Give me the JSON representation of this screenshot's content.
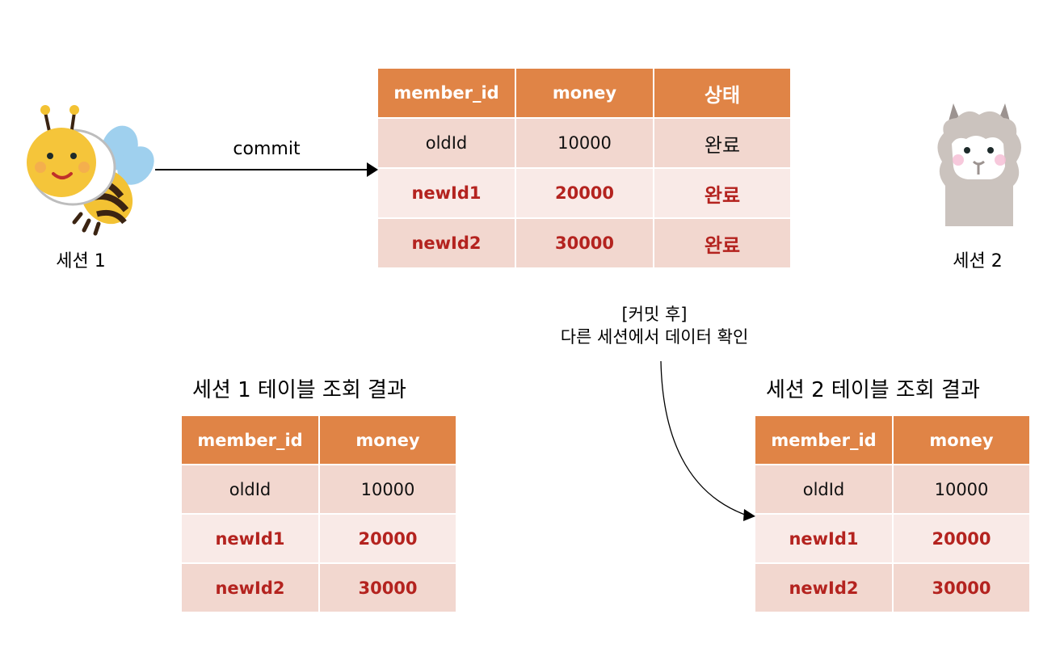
{
  "colors": {
    "header_bg": "#e08446",
    "row_odd_bg": "#f2d7cf",
    "row_even_bg": "#f9eae7",
    "highlight_text": "#b4231f",
    "normal_text": "#111111"
  },
  "session1": {
    "label": "세션 1",
    "icon": "bee-icon"
  },
  "session2": {
    "label": "세션 2",
    "icon": "alpaca-icon"
  },
  "commit_arrow": {
    "label": "commit"
  },
  "main_table": {
    "headers": [
      "member_id",
      "money",
      "상태"
    ],
    "rows": [
      {
        "cells": [
          "oldId",
          "10000",
          "완료"
        ],
        "highlight": false
      },
      {
        "cells": [
          "newId1",
          "20000",
          "완료"
        ],
        "highlight": true
      },
      {
        "cells": [
          "newId2",
          "30000",
          "완료"
        ],
        "highlight": true
      }
    ]
  },
  "note": {
    "line1": "[커밋 후]",
    "line2": "다른 세션에서 데이터 확인"
  },
  "session1_result": {
    "title": "세션 1 테이블 조회 결과",
    "headers": [
      "member_id",
      "money"
    ],
    "rows": [
      {
        "cells": [
          "oldId",
          "10000"
        ],
        "highlight": false
      },
      {
        "cells": [
          "newId1",
          "20000"
        ],
        "highlight": true
      },
      {
        "cells": [
          "newId2",
          "30000"
        ],
        "highlight": true
      }
    ]
  },
  "session2_result": {
    "title": "세션 2 테이블 조회 결과",
    "headers": [
      "member_id",
      "money"
    ],
    "rows": [
      {
        "cells": [
          "oldId",
          "10000"
        ],
        "highlight": false
      },
      {
        "cells": [
          "newId1",
          "20000"
        ],
        "highlight": true
      },
      {
        "cells": [
          "newId2",
          "30000"
        ],
        "highlight": true
      }
    ]
  }
}
